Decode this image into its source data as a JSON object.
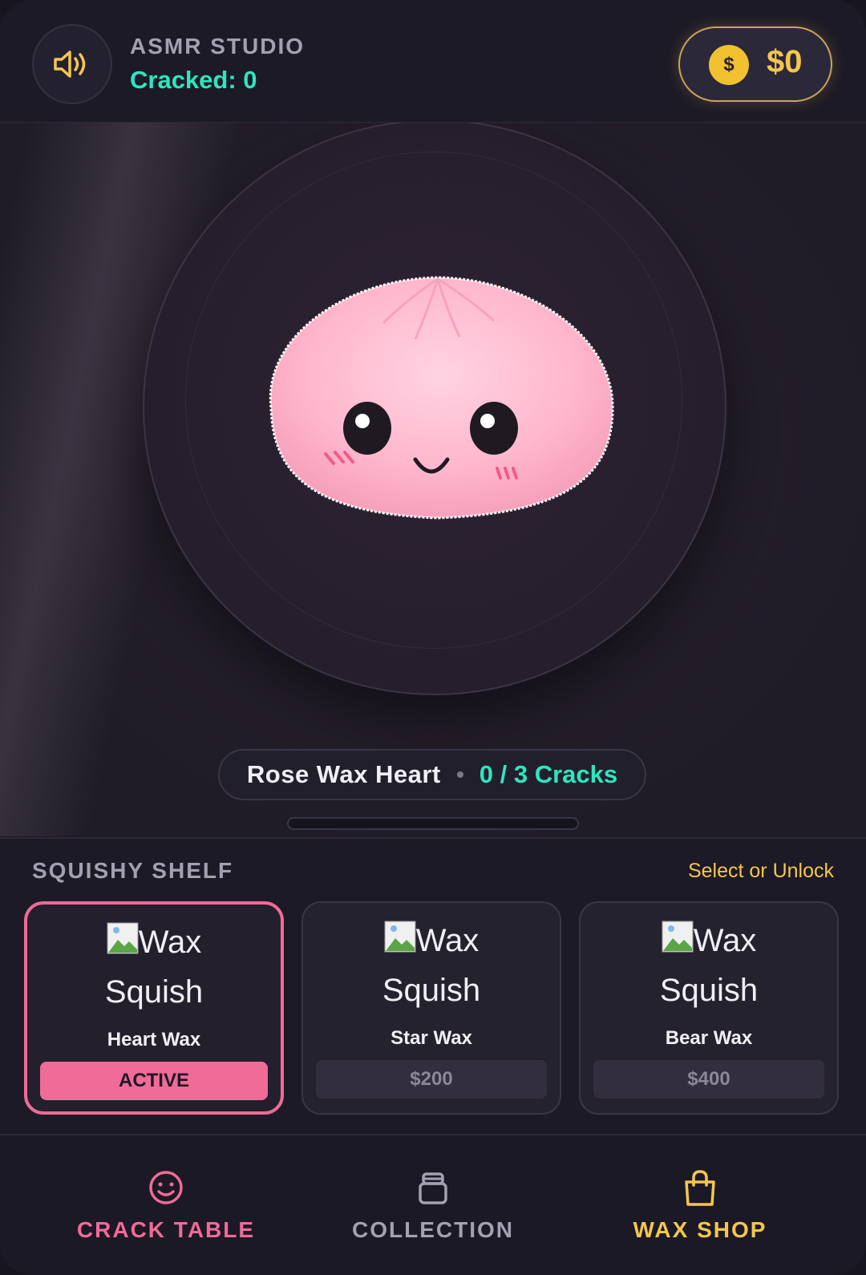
{
  "header": {
    "sound_icon": "speaker-volume-icon",
    "studio_title": "ASMR STUDIO",
    "cracked_label": "Cracked: 0",
    "coin_icon": "coin-icon",
    "coin_symbol": "$",
    "money": "$0"
  },
  "stage": {
    "squishy_name": "Rose Wax Heart",
    "crack_progress": "0 / 3 Cracks",
    "progress_fraction": 0.0
  },
  "shelf": {
    "title": "SQUISHY SHELF",
    "hint": "Select or Unlock",
    "cards": [
      {
        "alt_line1": "Wax",
        "alt_line2": "Squish",
        "name": "Heart Wax",
        "button": "ACTIVE",
        "state": "active"
      },
      {
        "alt_line1": "Wax",
        "alt_line2": "Squish",
        "name": "Star Wax",
        "button": "$200",
        "state": "locked"
      },
      {
        "alt_line1": "Wax",
        "alt_line2": "Squish",
        "name": "Bear Wax",
        "button": "$400",
        "state": "locked"
      }
    ]
  },
  "nav": {
    "items": [
      {
        "label": "CRACK TABLE",
        "icon": "smiley-icon",
        "color": "#f06b98"
      },
      {
        "label": "COLLECTION",
        "icon": "jar-icon",
        "color": "#a4a0b2"
      },
      {
        "label": "WAX SHOP",
        "icon": "shopping-bag-icon",
        "color": "#f5c64e"
      }
    ]
  },
  "colors": {
    "accent_teal": "#2ee6c0",
    "accent_pink": "#f06b98",
    "accent_gold": "#f5c64e",
    "background": "#1b1926"
  }
}
